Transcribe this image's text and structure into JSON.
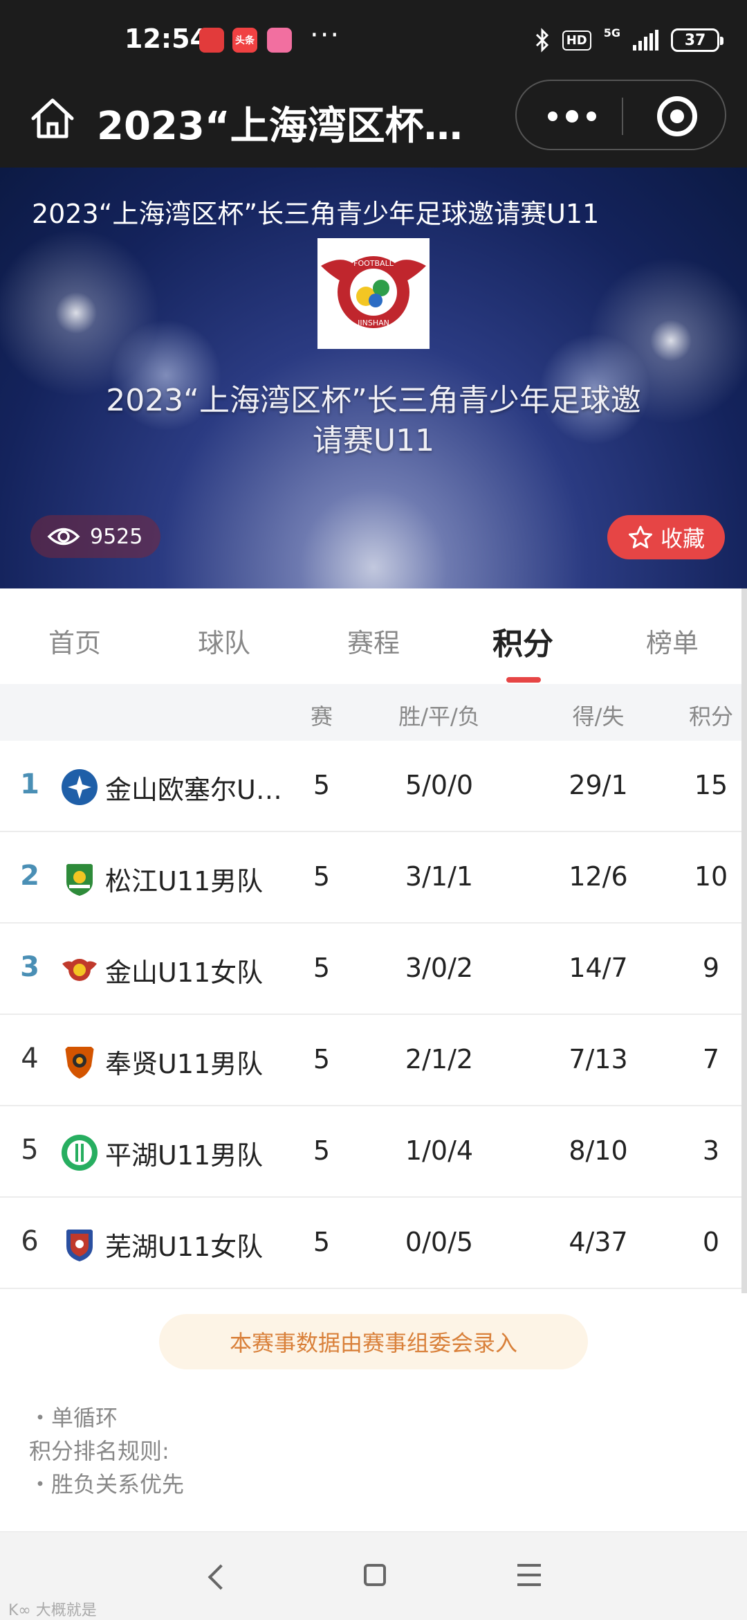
{
  "status_bar": {
    "time": "12:54",
    "app_icons": [
      {
        "name": "app-icon-red",
        "color": "#e23b3b",
        "label": ""
      },
      {
        "name": "toutiao-icon",
        "color": "#f04142",
        "label": "头条"
      },
      {
        "name": "app-icon-pink",
        "color": "#f26fa0",
        "label": ""
      }
    ],
    "more": "···",
    "hd": "HD",
    "network": "5G",
    "battery": "37"
  },
  "header": {
    "title": "2023“上海湾区杯…"
  },
  "banner": {
    "top_title": "2023“上海湾区杯”长三角青少年足球邀请赛U11",
    "logo_text_top": "FOOTBALL",
    "logo_text_bottom": "JINSHAN",
    "center_title_line1": "2023“上海湾区杯”长三角青少年足球邀",
    "center_title_line2": "请赛U11",
    "views": "9525",
    "favorite_label": "收藏"
  },
  "tabs": [
    {
      "label": "首页",
      "active": false
    },
    {
      "label": "球队",
      "active": false
    },
    {
      "label": "赛程",
      "active": false
    },
    {
      "label": "积分",
      "active": true
    },
    {
      "label": "榜单",
      "active": false
    }
  ],
  "table": {
    "headers": {
      "games": "赛",
      "wdl": "胜/平/负",
      "gf_ga": "得/失",
      "points": "积分"
    },
    "rows": [
      {
        "rank": "1",
        "team": "金山欧塞尔U…",
        "games": "5",
        "wdl": "5/0/0",
        "gf_ga": "29/1",
        "points": "15",
        "crest_color": "#1f5fa8",
        "crest_icon": "auxerre-crest"
      },
      {
        "rank": "2",
        "team": "松江U11男队",
        "games": "5",
        "wdl": "3/1/1",
        "gf_ga": "12/6",
        "points": "10",
        "crest_color": "#2e8b3a",
        "crest_icon": "songjiang-crest"
      },
      {
        "rank": "3",
        "team": "金山U11女队",
        "games": "5",
        "wdl": "3/0/2",
        "gf_ga": "14/7",
        "points": "9",
        "crest_color": "#c0392b",
        "crest_icon": "jinshan-crest"
      },
      {
        "rank": "4",
        "team": "奉贤U11男队",
        "games": "5",
        "wdl": "2/1/2",
        "gf_ga": "7/13",
        "points": "7",
        "crest_color": "#d35400",
        "crest_icon": "fengxian-crest"
      },
      {
        "rank": "5",
        "team": "平湖U11男队",
        "games": "5",
        "wdl": "1/0/4",
        "gf_ga": "8/10",
        "points": "3",
        "crest_color": "#27ae60",
        "crest_icon": "pinghu-crest"
      },
      {
        "rank": "6",
        "team": "芜湖U11女队",
        "games": "5",
        "wdl": "0/0/5",
        "gf_ga": "4/37",
        "points": "0",
        "crest_color": "#c0392b",
        "crest_icon": "wuhu-crest"
      }
    ]
  },
  "notice": "本赛事数据由赛事组委会录入",
  "rules": {
    "format": "・单循环",
    "ranking_title": "积分排名规则:",
    "ranking_rule": "・胜负关系优先"
  },
  "watermark": "K∞ 大概就是",
  "colors": {
    "accent": "#e64545",
    "top_rank": "#4a8fb5",
    "notice_text": "#d9803a"
  }
}
